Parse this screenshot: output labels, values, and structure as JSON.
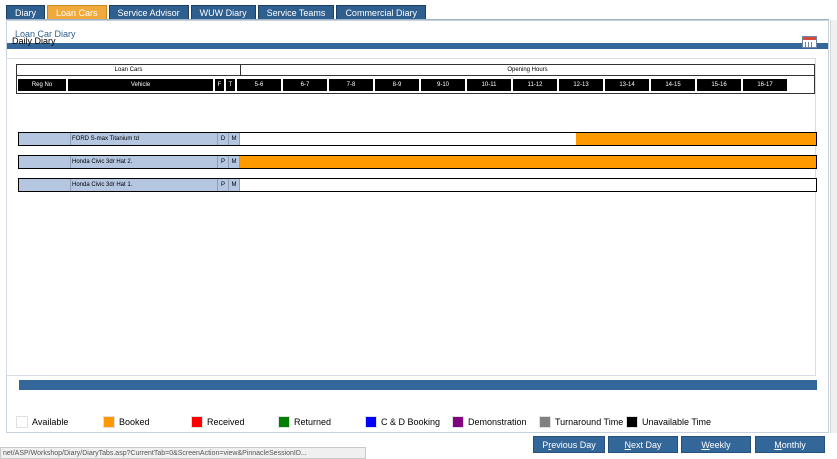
{
  "tabs": [
    {
      "label": "Diary",
      "active": false
    },
    {
      "label": "Loan Cars",
      "active": true
    },
    {
      "label": "Service Advisor",
      "active": false
    },
    {
      "label": "WUW Diary",
      "active": false
    },
    {
      "label": "Service Teams",
      "active": false
    },
    {
      "label": "Commercial Diary",
      "active": false
    }
  ],
  "panel": {
    "title": "Loan Car Diary",
    "subtitle": "Daily Diary"
  },
  "header": {
    "loan_cars_label": "Loan Cars",
    "opening_hours_label": "Opening Hours",
    "columns": [
      "Reg No",
      "Vehicle",
      "F",
      "T"
    ],
    "hours": [
      "5-6",
      "6-7",
      "7-8",
      "8-9",
      "9-10",
      "10-11",
      "11-12",
      "12-13",
      "13-14",
      "14-15",
      "15-16",
      "16-17"
    ]
  },
  "rows": [
    {
      "reg_no": "",
      "vehicle": "FORD S-max Titanium td",
      "fuel": "D",
      "trans": "M",
      "booked_from_fraction": 0.583,
      "booked_to_fraction": 1.0
    },
    {
      "reg_no": "",
      "vehicle": "Honda Civic 3dr Hat 2.",
      "fuel": "P",
      "trans": "M",
      "booked_from_fraction": 0.0,
      "booked_to_fraction": 1.0
    },
    {
      "reg_no": "",
      "vehicle": "Honda Civic 3dr Hat 1.",
      "fuel": "P",
      "trans": "M",
      "booked_from_fraction": 0.0,
      "booked_to_fraction": 0.0
    }
  ],
  "legend": [
    {
      "label": "Available",
      "color": "#ffffff"
    },
    {
      "label": "Booked",
      "color": "#ff9900"
    },
    {
      "label": "Received",
      "color": "#ff0000"
    },
    {
      "label": "Returned",
      "color": "#008000"
    },
    {
      "label": "C & D Booking",
      "color": "#0000ff"
    },
    {
      "label": "Demonstration",
      "color": "#800080"
    },
    {
      "label": "Turnaround Time",
      "color": "#808080"
    },
    {
      "label": "Unavailable Time",
      "color": "#000000"
    }
  ],
  "buttons": {
    "previous_day_pre": "P",
    "previous_day_u": "r",
    "previous_day_post": "evious Day",
    "next_day_pre": "",
    "next_day_u": "N",
    "next_day_post": "ext Day",
    "weekly_pre": "",
    "weekly_u": "W",
    "weekly_post": "eekly",
    "monthly_pre": "",
    "monthly_u": "M",
    "monthly_post": "onthly"
  },
  "status_url": "net/ASP/Workshop/Diary/DiaryTabs.asp?CurrentTab=0&ScreenAction=view&PinnacleSessionID..."
}
